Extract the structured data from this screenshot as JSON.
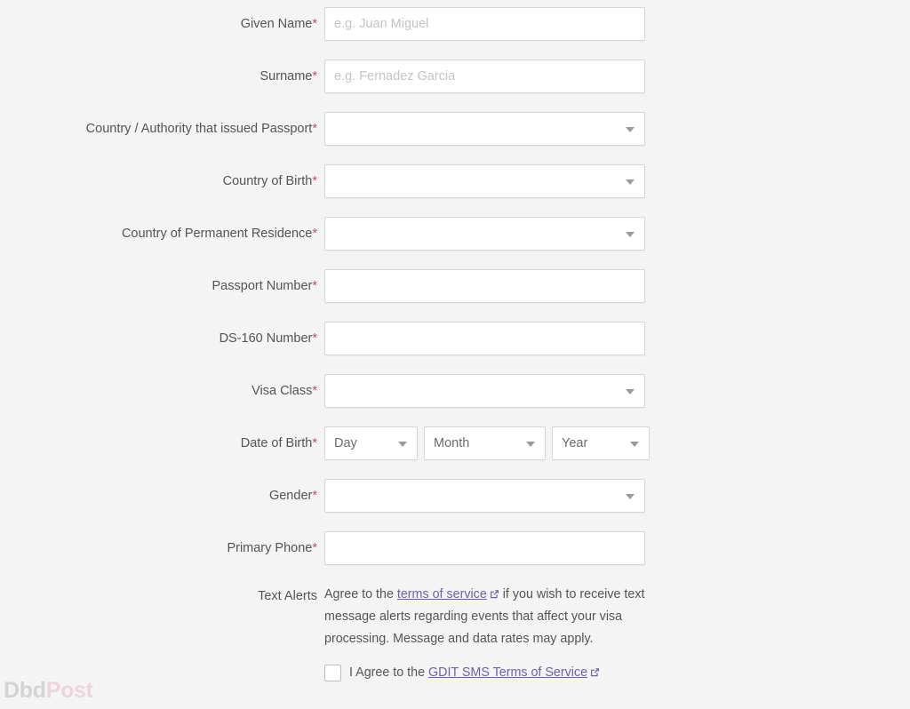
{
  "form": {
    "fields": [
      {
        "label": "Given Name",
        "required": true,
        "type": "text",
        "value": "",
        "placeholder": "e.g. Juan Miguel",
        "name": "given-name"
      },
      {
        "label": "Surname",
        "required": true,
        "type": "text",
        "value": "",
        "placeholder": "e.g. Fernadez Garcia",
        "name": "surname"
      },
      {
        "label": "Country / Authority that issued Passport",
        "required": true,
        "type": "select",
        "value": "",
        "name": "country-issued-passport"
      },
      {
        "label": "Country of Birth",
        "required": true,
        "type": "select",
        "value": "",
        "name": "country-of-birth"
      },
      {
        "label": "Country of Permanent Residence",
        "required": true,
        "type": "select",
        "value": "",
        "name": "country-of-permanent-residence"
      },
      {
        "label": "Passport Number",
        "required": true,
        "type": "text",
        "value": "",
        "placeholder": "",
        "name": "passport-number"
      },
      {
        "label": "DS-160 Number",
        "required": true,
        "type": "text",
        "value": "",
        "placeholder": "",
        "name": "ds-160-number"
      },
      {
        "label": "Visa Class",
        "required": true,
        "type": "select",
        "value": "",
        "name": "visa-class"
      },
      {
        "label": "Date of Birth",
        "required": true,
        "type": "date-trio",
        "name": "date-of-birth",
        "parts": [
          {
            "value": "Day",
            "name": "day"
          },
          {
            "value": "Month",
            "name": "month"
          },
          {
            "value": "Year",
            "name": "year"
          }
        ]
      },
      {
        "label": "Gender",
        "required": true,
        "type": "select",
        "value": "",
        "name": "gender"
      },
      {
        "label": "Primary Phone",
        "required": true,
        "type": "text",
        "value": "",
        "placeholder": "",
        "name": "primary-phone"
      }
    ],
    "required_marker": "*",
    "text_alerts": {
      "label": "Text Alerts",
      "required": false,
      "paragraph_before_link": "Agree to the ",
      "link_text": "terms of service",
      "paragraph_after_link": " if you wish to receive text message alerts regarding events that affect your visa processing. Message and data rates may apply.",
      "checkbox_checked": false,
      "agree_prefix": "I Agree to the ",
      "agree_link_text": "GDIT SMS Terms of Service"
    }
  },
  "watermark": {
    "part_one": "Dbd",
    "part_two": "Post"
  },
  "colors": {
    "background": "#f4f4f4",
    "field_background": "#ffffff",
    "field_border": "#d6d6d6",
    "label_text": "#545454",
    "required_asterisk": "#c0506a",
    "link": "#6b63a8",
    "placeholder": "#c4c4c4",
    "watermark_gray": "#8a8a8a",
    "watermark_pink": "#e08fa0"
  }
}
